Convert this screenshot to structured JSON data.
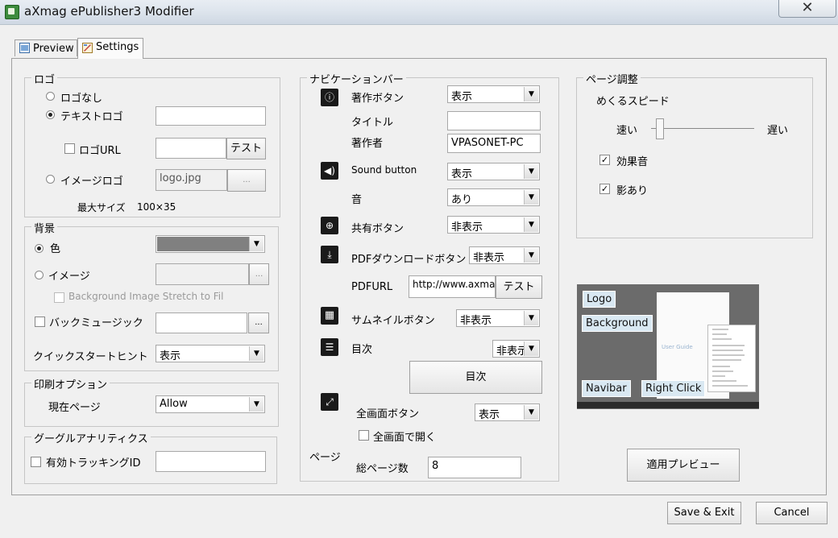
{
  "window": {
    "title": "aXmag ePublisher3 Modifier",
    "close_symbol": "✕"
  },
  "tabs": [
    {
      "label": "Preview"
    },
    {
      "label": "Settings"
    }
  ],
  "logo_group": {
    "title": "ロゴ",
    "no_logo_label": "ロゴなし",
    "text_logo_label": "テキストロゴ",
    "text_logo_value": "",
    "logo_url_label": "ロゴURL",
    "logo_url_value": "",
    "test_label": "テスト",
    "image_logo_label": "イメージロゴ",
    "image_logo_value": "logo.jpg",
    "browse_label": "...",
    "max_size_label": "最大サイズ",
    "max_size_value": "100×35"
  },
  "background_group": {
    "title": "背景",
    "color_label": "色",
    "color_swatch": "#808080",
    "image_label": "イメージ",
    "image_value": "",
    "browse_label": "...",
    "stretch_label": "Background Image Stretch to Fil",
    "music_label": "バックミュージック",
    "music_value": "",
    "music_browse_label": "...",
    "quickstart_label": "クイックスタートヒント",
    "quickstart_value": "表示"
  },
  "print_group": {
    "title": "印刷オプション",
    "current_page_label": "現在ページ",
    "current_page_value": "Allow"
  },
  "analytics_group": {
    "title": "グーグルアナリティクス",
    "tracking_label": "有効トラッキングID",
    "tracking_value": ""
  },
  "navbar_group": {
    "title": "ナビケーションバー",
    "copyright_label": "著作ボタン",
    "copyright_value": "表示",
    "title_label": "タイトル",
    "title_value": "",
    "author_label": "著作者",
    "author_value": "VPASONET-PC",
    "sound_label": "Sound button",
    "sound_value": "表示",
    "audio_label": "音",
    "audio_value": "あり",
    "share_label": "共有ボタン",
    "share_value": "非表示",
    "pdf_label": "PDFダウンロードボタン",
    "pdf_value": "非表示",
    "pdfurl_label": "PDFURL",
    "pdfurl_value": "http://www.axmag",
    "pdf_test_label": "テスト",
    "thumb_label": "サムネイルボタン",
    "thumb_value": "非表示",
    "toc_label": "目次",
    "toc_value": "非表示",
    "toc_button_label": "目次",
    "fullscreen_label": "全画面ボタン",
    "fullscreen_value": "表示",
    "open_fullscreen_label": "全画面で開く",
    "page_label": "ページ",
    "total_pages_label": "総ページ数",
    "total_pages_value": "8"
  },
  "page_adjust_group": {
    "title": "ページ調整",
    "flip_speed_label": "めくるスピード",
    "fast_label": "速い",
    "slow_label": "遅い",
    "speed_level": 0.05,
    "sound_effect_label": "効果音",
    "shadow_label": "影あり"
  },
  "preview": {
    "logo_callout": "Logo",
    "background_callout": "Background",
    "navibar_callout": "Navibar",
    "rightclick_callout": "Right Click",
    "page_caption": "User Guide"
  },
  "apply_preview_label": "適用プレビュー",
  "footer": {
    "save_exit_label": "Save & Exit",
    "cancel_label": "Cancel"
  }
}
